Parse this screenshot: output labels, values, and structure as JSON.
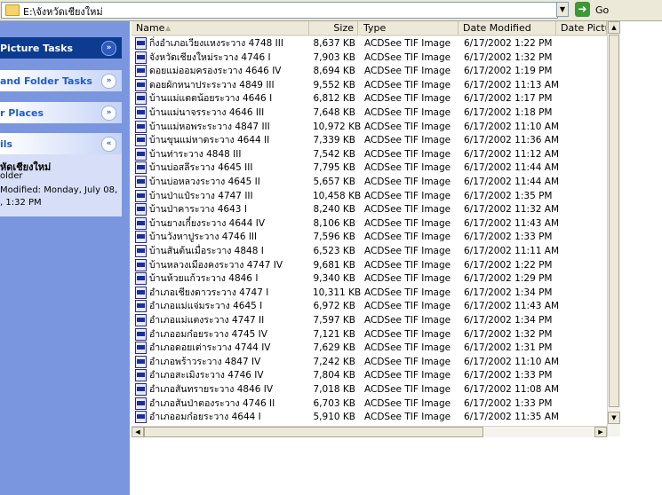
{
  "address": {
    "path": "E:\\จังหวัดเชียงใหม่",
    "dropdown_icon": "chevron-down-icon",
    "go_label": "Go",
    "go_icon": "arrow-right-icon"
  },
  "taskpane": {
    "sections": [
      {
        "title": "Picture Tasks",
        "collapsed_icon": "double-chevron-down-icon"
      },
      {
        "title": "and Folder Tasks",
        "collapsed_icon": "double-chevron-down-icon"
      },
      {
        "title": "r Places",
        "collapsed_icon": "double-chevron-down-icon"
      },
      {
        "title": "ils",
        "collapsed_icon": "double-chevron-up-icon"
      }
    ],
    "details": {
      "name": "หัดเชียงใหม่",
      "kind": "older",
      "modified_line1": "Modified: Monday, July 08,",
      "modified_line2": ", 1:32 PM"
    }
  },
  "columns": {
    "name": "Name",
    "size": "Size",
    "type": "Type",
    "date_modified": "Date Modified",
    "date_picture": "Date Pictur"
  },
  "files": [
    {
      "name": "กิ่งอำเภอเวียงแหงระวาง 4748 III",
      "size": "8,637 KB",
      "type": "ACDSee TIF Image",
      "date": "6/17/2002 1:22 PM"
    },
    {
      "name": "จังหวัดเชียงใหม่ระวาง 4746 I",
      "size": "7,903 KB",
      "type": "ACDSee TIF Image",
      "date": "6/17/2002 1:32 PM"
    },
    {
      "name": "ดอยแม่ออมครองระวาง 4646 IV",
      "size": "8,694 KB",
      "type": "ACDSee TIF Image",
      "date": "6/17/2002 1:19 PM"
    },
    {
      "name": "ดอยผักหนาประระวาง 4849 III",
      "size": "9,552 KB",
      "type": "ACDSee TIF Image",
      "date": "6/17/2002 11:13 AM"
    },
    {
      "name": "บ้านแม่แตตน้อยระวาง 4646 I",
      "size": "6,812 KB",
      "type": "ACDSee TIF Image",
      "date": "6/17/2002 1:17 PM"
    },
    {
      "name": "บ้านแม่นาจรระวาง 4646 III",
      "size": "7,648 KB",
      "type": "ACDSee TIF Image",
      "date": "6/17/2002 1:18 PM"
    },
    {
      "name": "บ้านแม่หอพระระวาง 4847 III",
      "size": "10,972 KB",
      "type": "ACDSee TIF Image",
      "date": "6/17/2002 11:10 AM"
    },
    {
      "name": "บ้านขุนแม่หาดระวาง 4644 II",
      "size": "7,339 KB",
      "type": "ACDSee TIF Image",
      "date": "6/17/2002 11:36 AM"
    },
    {
      "name": "บ้านท่าระวาง 4848 III",
      "size": "7,542 KB",
      "type": "ACDSee TIF Image",
      "date": "6/17/2002 11:12 AM"
    },
    {
      "name": "บ้านบ่อสลีระวาง 4645 III",
      "size": "7,795 KB",
      "type": "ACDSee TIF Image",
      "date": "6/17/2002 11:44 AM"
    },
    {
      "name": "บ้านบ่อหลวงระวาง 4645 II",
      "size": "5,657 KB",
      "type": "ACDSee TIF Image",
      "date": "6/17/2002 11:44 AM"
    },
    {
      "name": "บ้านป่าแป๋ระวาง 4747 III",
      "size": "10,458 KB",
      "type": "ACDSee TIF Image",
      "date": "6/17/2002 1:35 PM"
    },
    {
      "name": "บ้านป่าคาระวาง 4643 I",
      "size": "8,240 KB",
      "type": "ACDSee TIF Image",
      "date": "6/17/2002 11:32 AM"
    },
    {
      "name": "บ้านยางเกี๋ยงระวาง 4644 IV",
      "size": "8,106 KB",
      "type": "ACDSee TIF Image",
      "date": "6/17/2002 11:43 AM"
    },
    {
      "name": "บ้านวังหาปูระวาง 4746 III",
      "size": "7,596 KB",
      "type": "ACDSee TIF Image",
      "date": "6/17/2002 1:33 PM"
    },
    {
      "name": "บ้านสันต้นเมื่อระวาง 4848 I",
      "size": "6,523 KB",
      "type": "ACDSee TIF Image",
      "date": "6/17/2002 11:11 AM"
    },
    {
      "name": "บ้านหลวงเมืองคงระวาง 4747 IV",
      "size": "9,681 KB",
      "type": "ACDSee TIF Image",
      "date": "6/17/2002 1:22 PM"
    },
    {
      "name": "บ้านห้วยแก้วระวาง 4846 I",
      "size": "9,340 KB",
      "type": "ACDSee TIF Image",
      "date": "6/17/2002 1:29 PM"
    },
    {
      "name": "อำเภอเชียงดาวระวาง 4747 I",
      "size": "10,311 KB",
      "type": "ACDSee TIF Image",
      "date": "6/17/2002 1:34 PM"
    },
    {
      "name": "อำเภอแม่แจ่มระวาง 4645 I",
      "size": "6,972 KB",
      "type": "ACDSee TIF Image",
      "date": "6/17/2002 11:43 AM"
    },
    {
      "name": "อำเภอแม่แตงระวาง 4747 II",
      "size": "7,597 KB",
      "type": "ACDSee TIF Image",
      "date": "6/17/2002 1:34 PM"
    },
    {
      "name": "อำเภออมก๋อยระวาง 4745 IV",
      "size": "7,121 KB",
      "type": "ACDSee TIF Image",
      "date": "6/17/2002 1:32 PM"
    },
    {
      "name": "อำเภอดอยเต่าระวาง 4744 IV",
      "size": "7,629 KB",
      "type": "ACDSee TIF Image",
      "date": "6/17/2002 1:31 PM"
    },
    {
      "name": "อำเภอพร้าวระวาง 4847 IV",
      "size": "7,242 KB",
      "type": "ACDSee TIF Image",
      "date": "6/17/2002 11:10 AM"
    },
    {
      "name": "อำเภอสะเมิงระวาง 4746 IV",
      "size": "7,804 KB",
      "type": "ACDSee TIF Image",
      "date": "6/17/2002 1:33 PM"
    },
    {
      "name": "อำเภอสันทรายระวาง 4846 IV",
      "size": "7,018 KB",
      "type": "ACDSee TIF Image",
      "date": "6/17/2002 11:08 AM"
    },
    {
      "name": "อำเภอสันป่าตองระวาง 4746 II",
      "size": "6,703 KB",
      "type": "ACDSee TIF Image",
      "date": "6/17/2002 1:33 PM"
    },
    {
      "name": "อำเภออมก๋อยระวาง 4644 I",
      "size": "5,910 KB",
      "type": "ACDSee TIF Image",
      "date": "6/17/2002 11:35 AM"
    }
  ],
  "icons": {
    "file_icon": "tif-image-icon",
    "folder_icon": "folder-icon",
    "sort_icon": "sort-up-icon"
  },
  "colors": {
    "taskpane_bg": "#7a96df",
    "special_header": "#0c3b8f",
    "go_green": "#3b9a36"
  }
}
